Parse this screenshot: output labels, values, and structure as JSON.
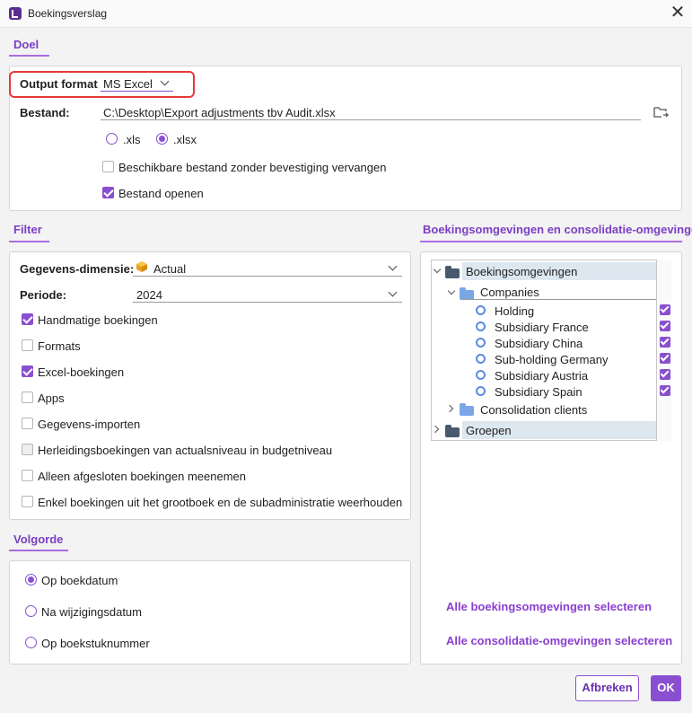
{
  "window": {
    "title": "Boekingsverslag"
  },
  "doel": {
    "section_label": "Doel",
    "output_format_label": "Output format",
    "output_format_value": "MS Excel",
    "bestand_label": "Bestand:",
    "bestand_value": "C:\\Desktop\\Export adjustments tbv Audit.xlsx",
    "ext_options": [
      ".xls",
      ".xlsx"
    ],
    "ext_selected": ".xlsx",
    "replace_label": "Beschikbare bestand zonder bevestiging vervangen",
    "replace_checked": false,
    "open_label": "Bestand openen",
    "open_checked": true
  },
  "filter": {
    "section_label": "Filter",
    "dimensie_label": "Gegevens-dimensie:",
    "dimensie_value": "Actual",
    "periode_label": "Periode:",
    "periode_value": "2024",
    "checkboxes": [
      {
        "label": "Handmatige boekingen",
        "checked": true
      },
      {
        "label": "Formats",
        "checked": false
      },
      {
        "label": "Excel-boekingen",
        "checked": true
      },
      {
        "label": "Apps",
        "checked": false
      },
      {
        "label": "Gegevens-importen",
        "checked": false
      },
      {
        "label": "Herleidingsboekingen van actualsniveau in budgetniveau",
        "checked": false
      },
      {
        "label": "Alleen afgesloten boekingen meenemen",
        "checked": false
      },
      {
        "label": "Enkel boekingen uit het grootboek en de subadministratie weerhouden",
        "checked": false
      }
    ]
  },
  "volgorde": {
    "section_label": "Volgorde",
    "options": [
      {
        "label": "Op boekdatum",
        "checked": true
      },
      {
        "label": "Na wijzigingsdatum",
        "checked": false
      },
      {
        "label": "Op boekstuknummer",
        "checked": false
      }
    ]
  },
  "omgevingen": {
    "section_label": "Boekingsomgevingen en consolidatie-omgevingen",
    "tree": {
      "root1": "Boekingsomgevingen",
      "companies": "Companies",
      "entities": [
        {
          "label": "Holding",
          "checked": true
        },
        {
          "label": "Subsidiary France",
          "checked": true
        },
        {
          "label": "Subsidiary China",
          "checked": true
        },
        {
          "label": "Sub-holding Germany",
          "checked": true
        },
        {
          "label": "Subsidiary Austria",
          "checked": true
        },
        {
          "label": "Subsidiary Spain",
          "checked": true
        }
      ],
      "consolidation": "Consolidation clients",
      "root2": "Groepen"
    },
    "link_select_booking": "Alle boekingsomgevingen selecteren",
    "link_select_consolidation": "Alle consolidatie-omgevingen selecteren"
  },
  "footer": {
    "cancel_label": "Afbreken",
    "ok_label": "OK"
  },
  "colors": {
    "accent": "#8a4fd0",
    "highlight": "#e43a3a",
    "folder_dark": "#4a5a6e",
    "folder_light": "#7aa6e6"
  },
  "icons": {
    "app": "app-logo-icon",
    "close": "close-icon",
    "browse": "folder-browse-icon",
    "dimension": "cube-icon"
  }
}
